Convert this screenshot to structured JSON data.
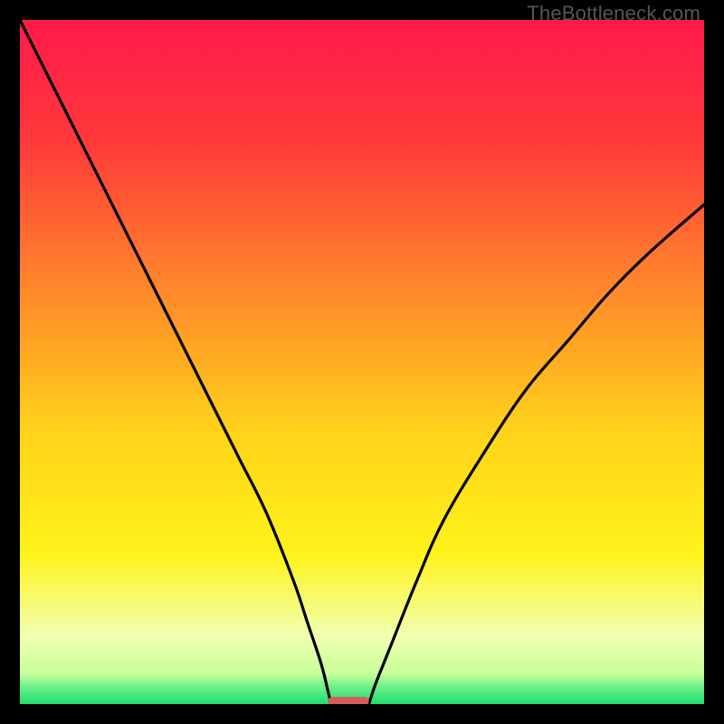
{
  "watermark": "TheBottleneck.com",
  "chart_data": {
    "type": "line",
    "title": "",
    "xlabel": "",
    "ylabel": "",
    "xlim": [
      0,
      100
    ],
    "ylim": [
      0,
      100
    ],
    "gradient_stops": [
      {
        "offset": 0.0,
        "color": "#ff1a4b"
      },
      {
        "offset": 0.18,
        "color": "#ff3a3a"
      },
      {
        "offset": 0.4,
        "color": "#ff8a2a"
      },
      {
        "offset": 0.6,
        "color": "#ffd21a"
      },
      {
        "offset": 0.78,
        "color": "#fff31a"
      },
      {
        "offset": 0.9,
        "color": "#f2ffb0"
      },
      {
        "offset": 0.955,
        "color": "#c8ff9a"
      },
      {
        "offset": 0.975,
        "color": "#6cf08c"
      },
      {
        "offset": 1.0,
        "color": "#1fdc6f"
      }
    ],
    "series": [
      {
        "name": "left-branch",
        "x": [
          0,
          4,
          8,
          12,
          16,
          20,
          24,
          28,
          32,
          36,
          40,
          42,
          44,
          45,
          45.5
        ],
        "values": [
          100,
          92,
          84,
          76,
          68,
          60,
          52,
          44,
          36,
          28,
          18,
          12,
          6,
          2,
          0
        ]
      },
      {
        "name": "right-branch",
        "x": [
          51,
          52,
          54,
          58,
          62,
          68,
          74,
          80,
          86,
          92,
          100
        ],
        "values": [
          0,
          3,
          8,
          18,
          27,
          37,
          46,
          53,
          60,
          66,
          73
        ]
      }
    ],
    "marker": {
      "x_center": 48,
      "x_half_width": 3,
      "y": 0,
      "color": "#d95a5a"
    }
  }
}
